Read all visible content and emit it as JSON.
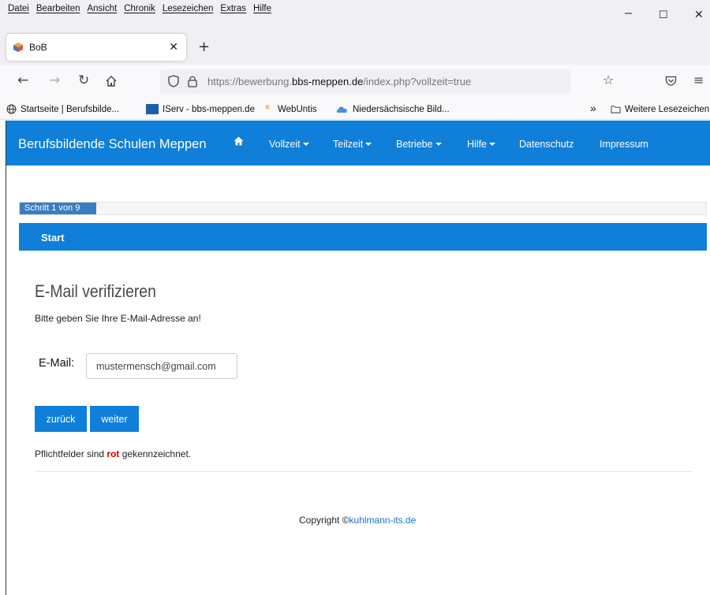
{
  "browser": {
    "menu": [
      "Datei",
      "Bearbeiten",
      "Ansicht",
      "Chronik",
      "Lesezeichen",
      "Extras",
      "Hilfe"
    ],
    "window_controls": [
      "–",
      "☐",
      "✕"
    ],
    "tab": {
      "title": "BoB",
      "close": "✕"
    },
    "new_tab": "+",
    "url": {
      "prefix": "https://bewerbung.",
      "domain": "bbs-meppen.de",
      "path": "/index.php?vollzeit=true"
    },
    "bookmarks": [
      "Startseite | Berufsbilde...",
      "IServ - bbs-meppen.de",
      "WebUntis",
      "Niedersächsische Bild..."
    ],
    "bookmarks_overflow": "»",
    "other_bookmarks": "Weitere Lesezeichen"
  },
  "site": {
    "brand": "Berufsbildende Schulen Meppen",
    "nav": [
      {
        "label": "Vollzeit",
        "dropdown": true
      },
      {
        "label": "Teilzeit",
        "dropdown": true
      },
      {
        "label": "Betriebe",
        "dropdown": true
      },
      {
        "label": "Hilfe",
        "dropdown": true
      },
      {
        "label": "Datenschutz",
        "dropdown": false
      },
      {
        "label": "Impressum",
        "dropdown": false
      }
    ],
    "colors": {
      "primary": "#0f7fd9",
      "progress": "#3a7dc3",
      "required": "#d40000",
      "link": "#1a73c9"
    }
  },
  "progress": {
    "label": "Schritt 1 von 9",
    "step": 1,
    "total": 9
  },
  "step_header": "Start",
  "form": {
    "title": "E-Mail verifizieren",
    "intro": "Bitte geben Sie Ihre E-Mail-Adresse an!",
    "email_label": "E-Mail:",
    "email_value": "mustermensch@gmail.com",
    "back_button": "zurück",
    "next_button": "weiter",
    "required_hint_before": "Pflichtfelder sind ",
    "required_hint_word": "rot",
    "required_hint_after": " gekennzeichnet."
  },
  "footer": {
    "copyright_prefix": "Copyright ©",
    "copyright_link": "kuhlmann-its.de"
  }
}
